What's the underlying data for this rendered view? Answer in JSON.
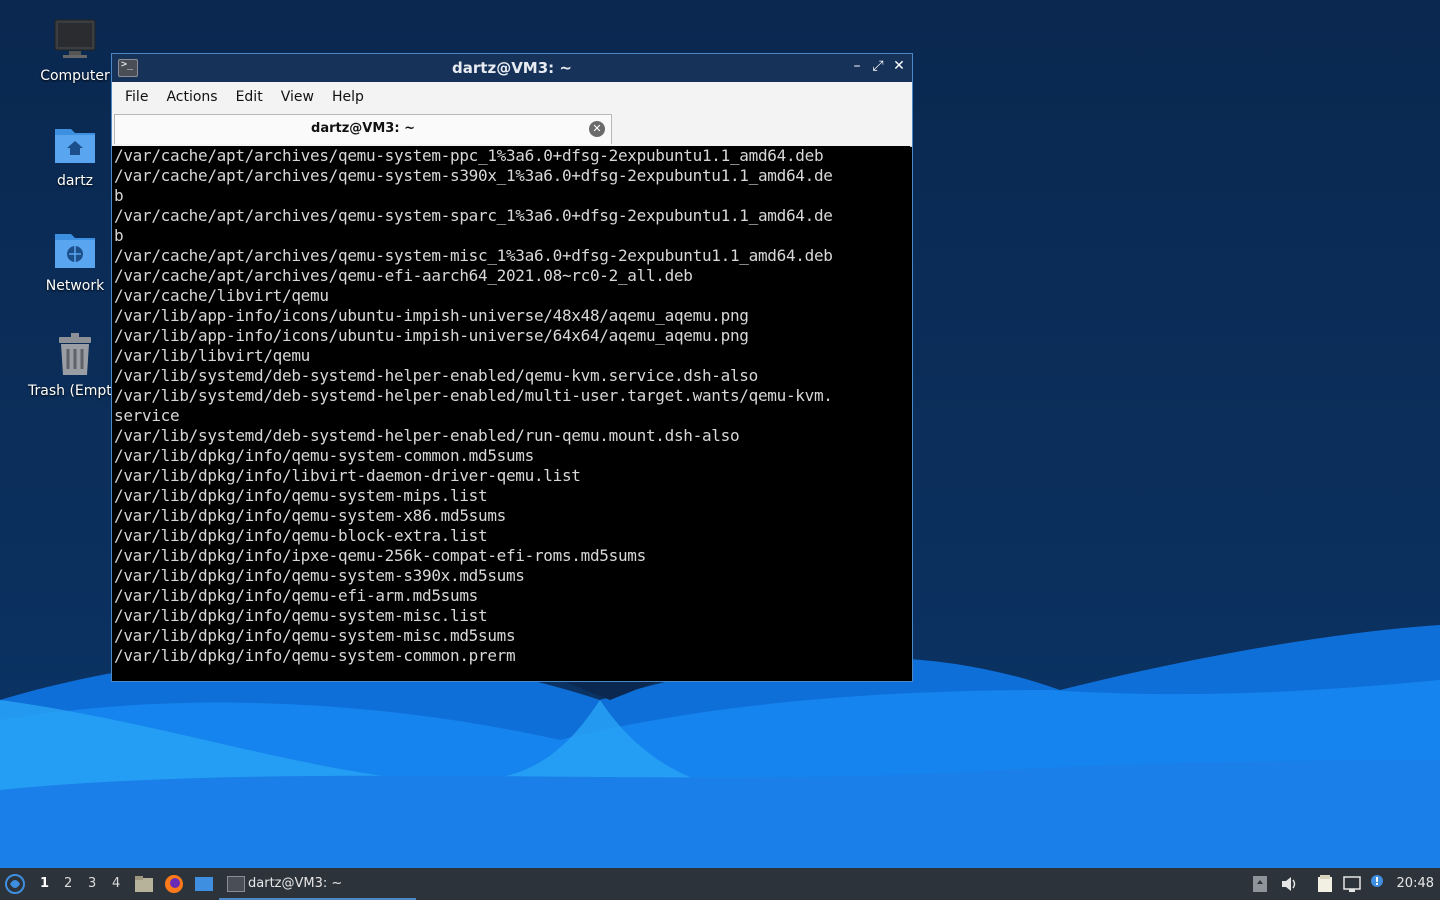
{
  "desktop": {
    "icons": [
      {
        "label": "Computer",
        "icon": "computer-icon"
      },
      {
        "label": "dartz",
        "icon": "home-folder-icon"
      },
      {
        "label": "Network",
        "icon": "network-folder-icon"
      },
      {
        "label": "Trash (Empt",
        "icon": "trash-icon"
      }
    ]
  },
  "window": {
    "title": "dartz@VM3: ~",
    "controls": {
      "minimize": "–",
      "maximize": "⤢",
      "close": "✕"
    },
    "menu": [
      "File",
      "Actions",
      "Edit",
      "View",
      "Help"
    ],
    "tab": {
      "label": "dartz@VM3: ~",
      "close": "✕"
    },
    "terminal_lines": [
      "/var/cache/apt/archives/qemu-system-ppc_1%3a6.0+dfsg-2expubuntu1.1_amd64.deb",
      "/var/cache/apt/archives/qemu-system-s390x_1%3a6.0+dfsg-2expubuntu1.1_amd64.de",
      "b",
      "/var/cache/apt/archives/qemu-system-sparc_1%3a6.0+dfsg-2expubuntu1.1_amd64.de",
      "b",
      "/var/cache/apt/archives/qemu-system-misc_1%3a6.0+dfsg-2expubuntu1.1_amd64.deb",
      "/var/cache/apt/archives/qemu-efi-aarch64_2021.08~rc0-2_all.deb",
      "/var/cache/libvirt/qemu",
      "/var/lib/app-info/icons/ubuntu-impish-universe/48x48/aqemu_aqemu.png",
      "/var/lib/app-info/icons/ubuntu-impish-universe/64x64/aqemu_aqemu.png",
      "/var/lib/libvirt/qemu",
      "/var/lib/systemd/deb-systemd-helper-enabled/qemu-kvm.service.dsh-also",
      "/var/lib/systemd/deb-systemd-helper-enabled/multi-user.target.wants/qemu-kvm.",
      "service",
      "/var/lib/systemd/deb-systemd-helper-enabled/run-qemu.mount.dsh-also",
      "/var/lib/dpkg/info/qemu-system-common.md5sums",
      "/var/lib/dpkg/info/libvirt-daemon-driver-qemu.list",
      "/var/lib/dpkg/info/qemu-system-mips.list",
      "/var/lib/dpkg/info/qemu-system-x86.md5sums",
      "/var/lib/dpkg/info/qemu-block-extra.list",
      "/var/lib/dpkg/info/ipxe-qemu-256k-compat-efi-roms.md5sums",
      "/var/lib/dpkg/info/qemu-system-s390x.md5sums",
      "/var/lib/dpkg/info/qemu-efi-arm.md5sums",
      "/var/lib/dpkg/info/qemu-system-misc.list",
      "/var/lib/dpkg/info/qemu-system-misc.md5sums",
      "/var/lib/dpkg/info/qemu-system-common.prerm"
    ]
  },
  "taskbar": {
    "workspaces": [
      "1",
      "2",
      "3",
      "4"
    ],
    "active_workspace": "1",
    "task_label": "dartz@VM3: ~",
    "clock": "20:48",
    "colors": {
      "accent": "#4a88c8",
      "panel": "#2d333b"
    }
  }
}
